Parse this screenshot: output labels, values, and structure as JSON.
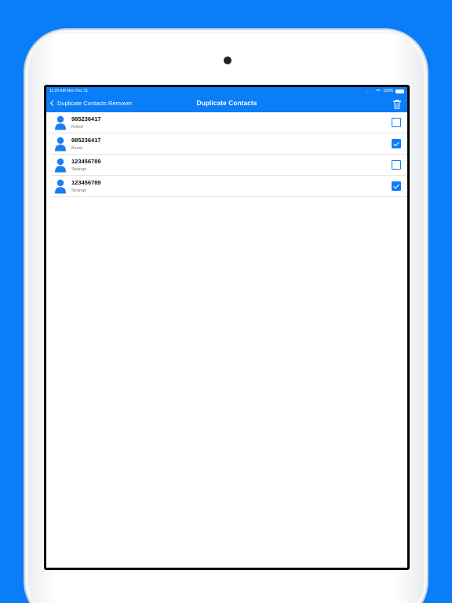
{
  "status_bar": {
    "time_date": "11:20 AM  Mon Dec 31",
    "signal": "....",
    "battery": "100%"
  },
  "nav": {
    "back_label": "Duplicate Contacts Remover",
    "title": "Duplicate Contacts",
    "trash_icon": "trash-icon"
  },
  "contacts": [
    {
      "number": "985236417",
      "name": "Robot",
      "checked": false
    },
    {
      "number": "985236417",
      "name": "Beast",
      "checked": true
    },
    {
      "number": "123456789",
      "name": "Strange",
      "checked": false
    },
    {
      "number": "123456789",
      "name": "Strange",
      "checked": true
    }
  ],
  "colors": {
    "background": "#0a7df9",
    "accent": "#0a7df9",
    "avatar": "#1a7ff0"
  }
}
